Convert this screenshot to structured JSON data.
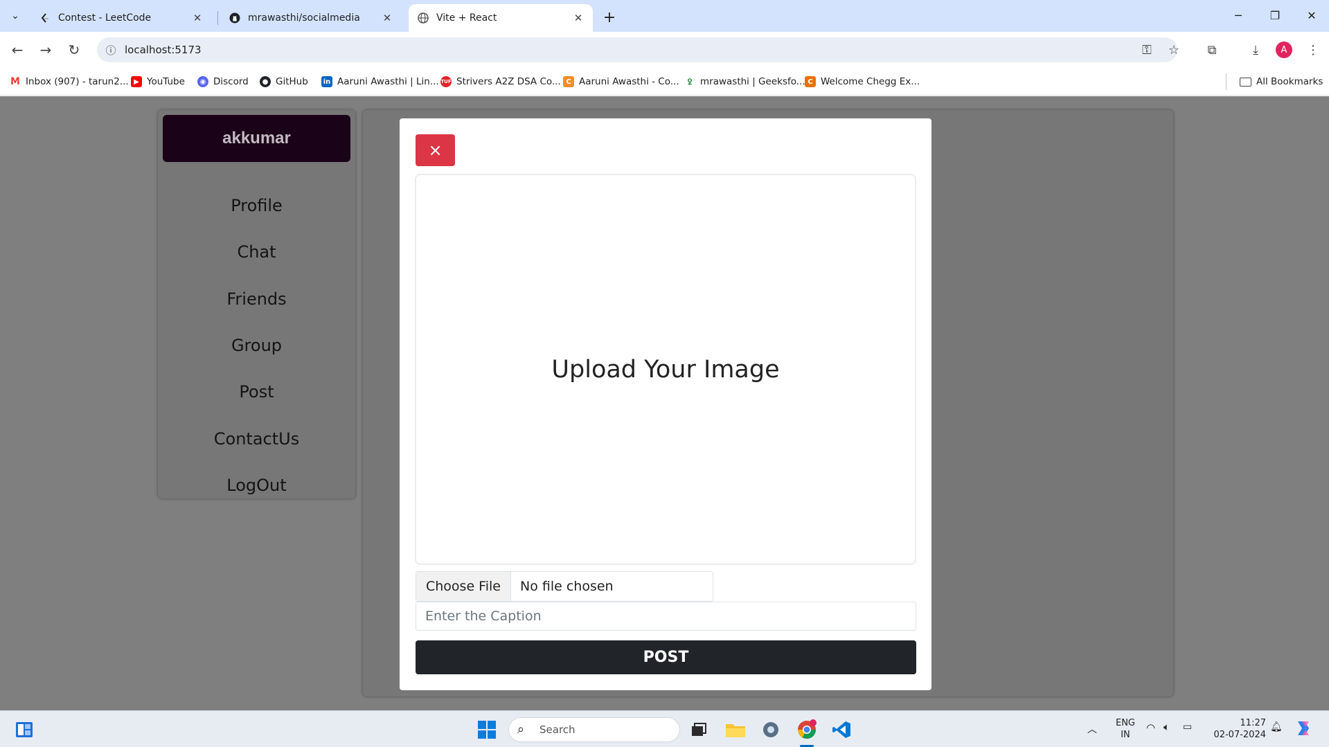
{
  "browser": {
    "tabs": [
      {
        "title": "Contest - LeetCode",
        "active": false
      },
      {
        "title": "mrawasthi/socialmedia",
        "active": false
      },
      {
        "title": "Vite + React",
        "active": true
      }
    ],
    "new_tab_symbol": "+",
    "tab_search_symbol": "⌄",
    "address": "localhost:5173",
    "bookmarks": [
      {
        "label": "Inbox (907) - tarun2...",
        "icon": "gmail-icon",
        "color": "#ea4335"
      },
      {
        "label": "YouTube",
        "icon": "youtube-icon",
        "color": "#ff0000"
      },
      {
        "label": "Discord",
        "icon": "discord-icon",
        "color": "#5865f2"
      },
      {
        "label": "GitHub",
        "icon": "github-icon",
        "color": "#1f2328"
      },
      {
        "label": "Aaruni Awasthi | Lin...",
        "icon": "linkedin-icon",
        "color": "#0a66c2"
      },
      {
        "label": "Strivers A2Z DSA Co...",
        "icon": "takeuforward-icon",
        "color": "#e0242c"
      },
      {
        "label": "Aaruni Awasthi - Co...",
        "icon": "codechef-icon",
        "color": "#f28c28"
      },
      {
        "label": "mrawasthi | Geeksfo...",
        "icon": "geeksforgeeks-icon",
        "color": "#2f8d46"
      },
      {
        "label": "Welcome Chegg Ex...",
        "icon": "chegg-icon",
        "color": "#eb7100"
      }
    ],
    "all_bookmarks": "All Bookmarks",
    "profile_initial": "A"
  },
  "app": {
    "username": "akkumar",
    "nav": [
      "Profile",
      "Chat",
      "Friends",
      "Group",
      "Post",
      "ContactUs",
      "LogOut"
    ],
    "modal": {
      "close_symbol": "×",
      "upload_text": "Upload Your Image",
      "choose_file": "Choose File",
      "file_status": "No file chosen",
      "caption_placeholder": "Enter the Caption",
      "post_label": "POST"
    }
  },
  "taskbar": {
    "search_placeholder": "Search",
    "lang_top": "ENG",
    "lang_bottom": "IN",
    "time": "11:27",
    "date": "02-07-2024"
  }
}
